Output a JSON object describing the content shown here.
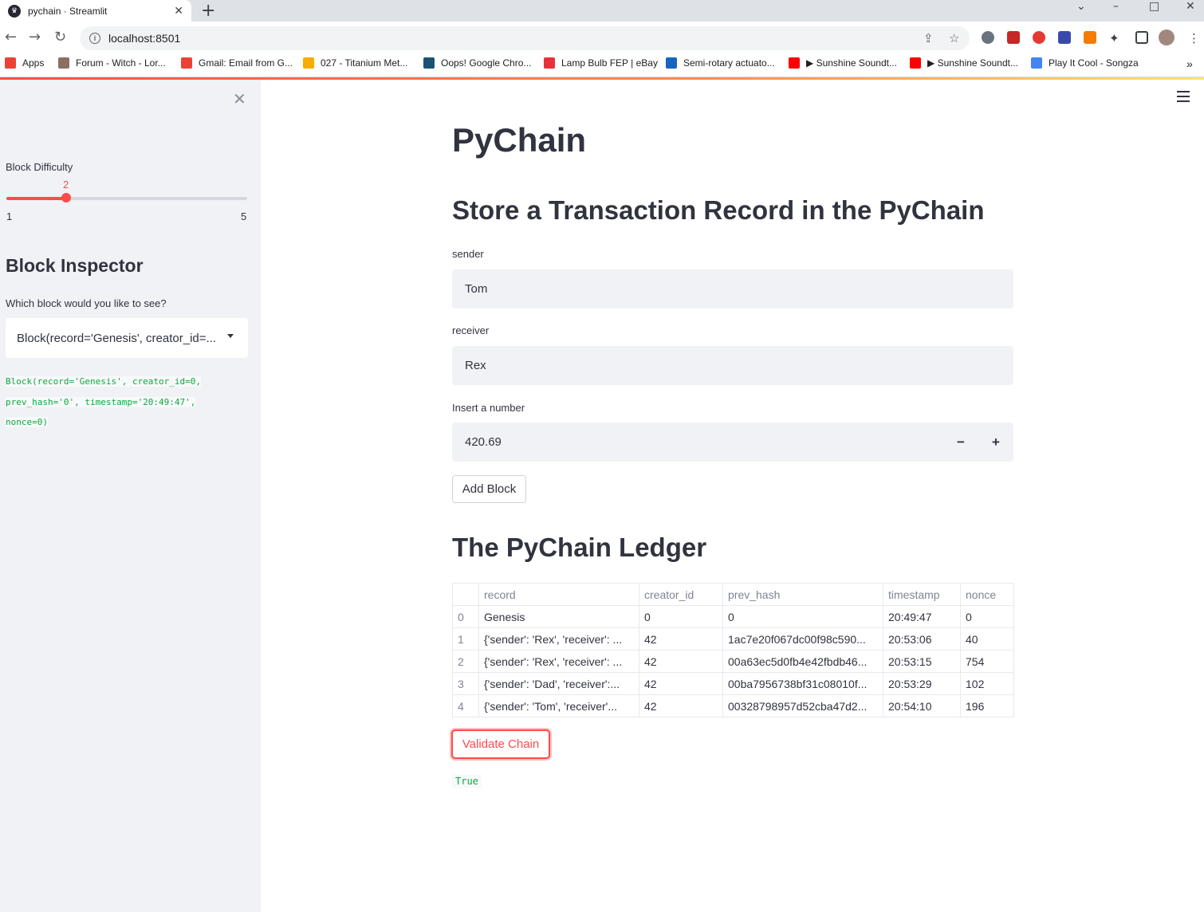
{
  "browser": {
    "tab_title": "pychain · Streamlit",
    "url": "localhost:8501",
    "bookmarks": [
      {
        "label": "Apps",
        "color": "#ea4335"
      },
      {
        "label": "Forum - Witch - Lor...",
        "color": "#8d6e63"
      },
      {
        "label": "Gmail: Email from G...",
        "color": "#ea4335"
      },
      {
        "label": "027 - Titanium Met...",
        "color": "#f9ab00"
      },
      {
        "label": "Oops! Google Chro...",
        "color": "#1a5276"
      },
      {
        "label": "Lamp Bulb FEP | eBay",
        "color": "#e53238"
      },
      {
        "label": "Semi-rotary actuato...",
        "color": "#1565c0"
      },
      {
        "label": "▶ Sunshine Soundt...",
        "color": "#ff0000"
      },
      {
        "label": "▶ Sunshine Soundt...",
        "color": "#ff0000"
      },
      {
        "label": "Play It Cool - Songza",
        "color": "#4285f4"
      }
    ]
  },
  "sidebar": {
    "difficulty_label": "Block Difficulty",
    "difficulty_value": "2",
    "difficulty_min": "1",
    "difficulty_max": "5",
    "inspector_title": "Block Inspector",
    "inspector_question": "Which block would you like to see?",
    "selected_block": "Block(record='Genesis', creator_id=...",
    "block_repr_lines": [
      "Block(record='Genesis', creator_id=0,",
      "prev_hash='0', timestamp='20:49:47',",
      "nonce=0)"
    ]
  },
  "main": {
    "title": "PyChain",
    "store_header": "Store a Transaction Record in the PyChain",
    "sender_label": "sender",
    "sender_value": "Tom",
    "receiver_label": "receiver",
    "receiver_value": "Rex",
    "amount_label": "Insert a number",
    "amount_value": "420.69",
    "minus": "−",
    "plus": "+",
    "add_block_label": "Add Block",
    "ledger_header": "The PyChain Ledger",
    "validate_label": "Validate Chain",
    "validate_result": "True"
  },
  "ledger": {
    "columns": [
      "",
      "record",
      "creator_id",
      "prev_hash",
      "timestamp",
      "nonce"
    ],
    "rows": [
      [
        "0",
        "Genesis",
        "0",
        "0",
        "20:49:47",
        "0"
      ],
      [
        "1",
        "{'sender': 'Rex', 'receiver': ...",
        "42",
        "1ac7e20f067dc00f98c590...",
        "20:53:06",
        "40"
      ],
      [
        "2",
        "{'sender': 'Rex', 'receiver': ...",
        "42",
        "00a63ec5d0fb4e42fbdb46...",
        "20:53:15",
        "754"
      ],
      [
        "3",
        "{'sender': 'Dad', 'receiver':...",
        "42",
        "00ba7956738bf31c08010f...",
        "20:53:29",
        "102"
      ],
      [
        "4",
        "{'sender': 'Tom', 'receiver'...",
        "42",
        "00328798957d52cba47d2...",
        "20:54:10",
        "196"
      ]
    ]
  },
  "colors": {
    "accent": "#ff4b4b",
    "sidebar_bg": "#f0f2f6",
    "code_green": "#09ab3b"
  }
}
